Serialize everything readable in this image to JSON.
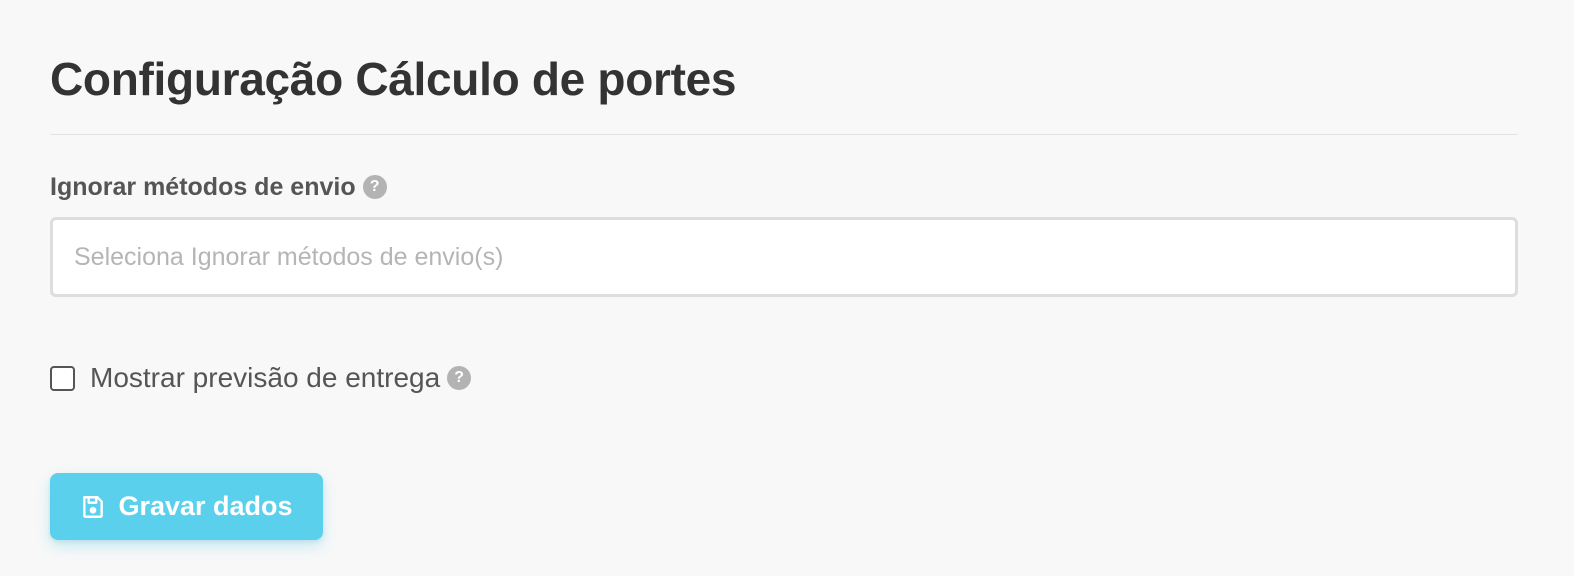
{
  "page": {
    "title": "Configuração Cálculo de portes"
  },
  "shipping_methods": {
    "label": "Ignorar métodos de envio",
    "help_icon": "question-circle-icon",
    "help_glyph": "?",
    "placeholder": "Seleciona Ignorar métodos de envio(s)"
  },
  "delivery_estimate": {
    "label": "Mostrar previsão de entrega",
    "checked": false,
    "help_icon": "question-circle-icon",
    "help_glyph": "?"
  },
  "save_button": {
    "label": "Gravar dados",
    "icon": "floppy-disk-icon"
  },
  "colors": {
    "accent": "#5bd0ec",
    "background": "#f8f8f8",
    "text": "#333333",
    "placeholder": "#b5b5b5"
  }
}
